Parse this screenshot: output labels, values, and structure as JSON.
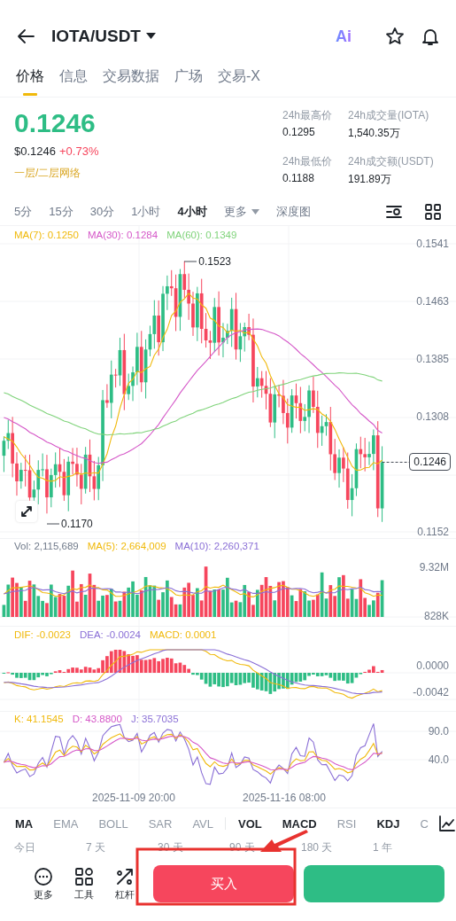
{
  "header": {
    "pair": "IOTA/USDT",
    "ai_badge": "Ai"
  },
  "tabs": [
    {
      "label": "价格",
      "selected": true
    },
    {
      "label": "信息",
      "selected": false
    },
    {
      "label": "交易数据",
      "selected": false
    },
    {
      "label": "广场",
      "selected": false
    },
    {
      "label": "交易-X",
      "selected": false
    }
  ],
  "price": {
    "last": "0.1246",
    "usd": "$0.1246",
    "change": "+0.73%",
    "network": "一层/二层网络"
  },
  "stats": [
    {
      "label": "24h最高价",
      "value": "0.1295"
    },
    {
      "label": "24h成交量(IOTA)",
      "value": "1,540.35万"
    },
    {
      "label": "24h最低价",
      "value": "0.1188"
    },
    {
      "label": "24h成交额(USDT)",
      "value": "191.89万"
    }
  ],
  "intervals": [
    {
      "label": "5分",
      "selected": false,
      "kind": "plain"
    },
    {
      "label": "15分",
      "selected": false,
      "kind": "plain"
    },
    {
      "label": "30分",
      "selected": false,
      "kind": "plain"
    },
    {
      "label": "1小时",
      "selected": false,
      "kind": "plain"
    },
    {
      "label": "4小时",
      "selected": true,
      "kind": "plain"
    },
    {
      "label": "更多",
      "selected": false,
      "kind": "dropdown"
    },
    {
      "label": "深度图",
      "selected": false,
      "kind": "plain"
    }
  ],
  "main_chart": {
    "legend": [
      {
        "text": "MA(7): 0.1250",
        "color": "#f0b90b"
      },
      {
        "text": "MA(30): 0.1284",
        "color": "#d558c8"
      },
      {
        "text": "MA(60): 0.1349",
        "color": "#7fd37a"
      }
    ],
    "y_axis": [
      "0.1541",
      "0.1463",
      "0.1385",
      "0.1308",
      "0.1152"
    ],
    "last_price": "0.1246",
    "high_marker": "0.1523",
    "low_marker": "0.1170"
  },
  "volume_chart": {
    "legend": [
      {
        "text": "Vol: 2,115,689",
        "color": "#707a8a"
      },
      {
        "text": "MA(5): 2,664,009",
        "color": "#f0b90b"
      },
      {
        "text": "MA(10): 2,260,371",
        "color": "#8a6fd6"
      }
    ],
    "y_axis": [
      "9.32M",
      "828K"
    ]
  },
  "macd_chart": {
    "legend": [
      {
        "text": "DIF: -0.0023",
        "color": "#f0b90b"
      },
      {
        "text": "DEA: -0.0024",
        "color": "#8a6fd6"
      },
      {
        "text": "MACD: 0.0001",
        "color": "#f0b90b"
      }
    ],
    "y_axis": [
      "0.0000",
      "-0.0042"
    ]
  },
  "kdj_chart": {
    "legend": [
      {
        "text": "K: 41.1545",
        "color": "#f0b90b"
      },
      {
        "text": "D: 43.8800",
        "color": "#d558c8"
      },
      {
        "text": "J: 35.7035",
        "color": "#8a6fd6"
      }
    ],
    "y_axis": [
      "90.0",
      "40.0"
    ]
  },
  "x_axis": [
    "2025-11-09 20:00",
    "2025-11-16 08:00"
  ],
  "indicators": [
    {
      "label": "MA",
      "selected": true,
      "divider_before": false
    },
    {
      "label": "EMA",
      "selected": false,
      "divider_before": false
    },
    {
      "label": "BOLL",
      "selected": false,
      "divider_before": false
    },
    {
      "label": "SAR",
      "selected": false,
      "divider_before": false
    },
    {
      "label": "AVL",
      "selected": false,
      "divider_before": false
    },
    {
      "label": "VOL",
      "selected": true,
      "divider_before": true
    },
    {
      "label": "MACD",
      "selected": true,
      "divider_before": false
    },
    {
      "label": "RSI",
      "selected": false,
      "divider_before": false
    },
    {
      "label": "KDJ",
      "selected": true,
      "divider_before": false
    },
    {
      "label": "C",
      "selected": false,
      "divider_before": false
    }
  ],
  "ranges": [
    "今日",
    "7 天",
    "30 天",
    "90 天",
    "180 天",
    "1 年"
  ],
  "actions": [
    {
      "label": "更多",
      "kind": "more"
    },
    {
      "label": "工具",
      "kind": "tools"
    },
    {
      "label": "杠杆",
      "kind": "leverage"
    }
  ],
  "trade_buttons": [
    {
      "label": "买入",
      "kind": "buy"
    },
    {
      "kind": "sell"
    }
  ],
  "annotation": {
    "kind": "arrow_box"
  }
}
